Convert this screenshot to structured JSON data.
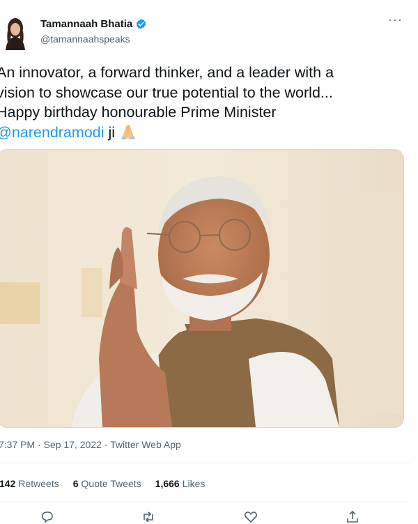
{
  "user": {
    "display_name": "Tamannaah Bhatia",
    "handle": "@tamannaahspeaks",
    "verified": true
  },
  "menu_icon": "more-horizontal-icon",
  "tweet": {
    "text_line1": "An innovator, a forward thinker, and a leader with a",
    "text_line2": "vision to showcase our true potential to the world...",
    "text_line3": "Happy birthday honourable Prime Minister",
    "mention": "@narendramodi",
    "suffix": " ji",
    "emoji": "folded-hands"
  },
  "meta": {
    "time": "7:37 PM",
    "separator1": " · ",
    "date": "Sep 17, 2022",
    "separator2": " · ",
    "source": "Twitter Web App"
  },
  "stats": {
    "retweets_count": "142",
    "retweets_label": "Retweets",
    "quotes_count": "6",
    "quotes_label": "Quote Tweets",
    "likes_count": "1,666",
    "likes_label": "Likes"
  },
  "actions": [
    "reply-icon",
    "retweet-icon",
    "like-icon",
    "share-icon"
  ],
  "colors": {
    "link": "#1d9bf0",
    "verified": "#1d9bf0",
    "secondary_text": "#536471"
  }
}
